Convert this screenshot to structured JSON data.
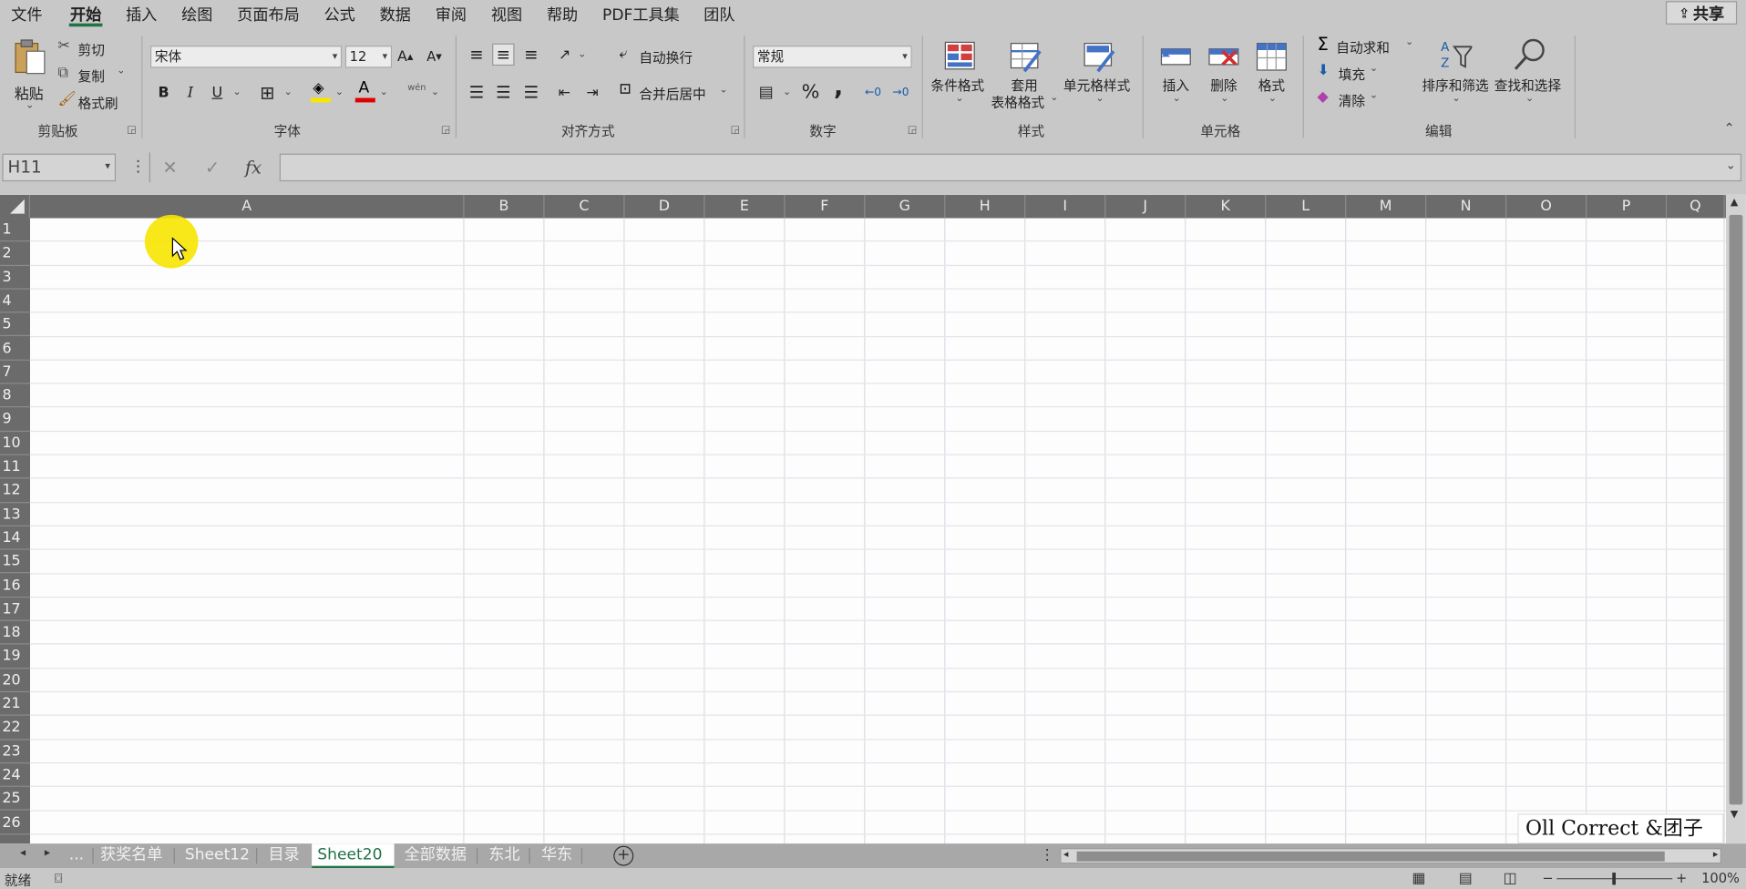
{
  "menu": {
    "items": [
      "文件",
      "开始",
      "插入",
      "绘图",
      "页面布局",
      "公式",
      "数据",
      "审阅",
      "视图",
      "帮助",
      "PDF工具集",
      "团队"
    ],
    "active": "开始",
    "share": "共享"
  },
  "ribbon": {
    "clipboard": {
      "paste": "粘贴",
      "cut": "剪切",
      "copy": "复制",
      "format_painter": "格式刷",
      "label": "剪贴板"
    },
    "font": {
      "name": "宋体",
      "size": "12",
      "bold": "B",
      "italic": "I",
      "underline": "U",
      "phonetic": "wén",
      "label": "字体"
    },
    "alignment": {
      "wrap": "自动换行",
      "merge": "合并后居中",
      "label": "对齐方式"
    },
    "number": {
      "format": "常规",
      "percent": "%",
      "comma": ",",
      "label": "数字"
    },
    "styles": {
      "conditional": "条件格式",
      "table_line1": "套用",
      "table_line2": "表格格式",
      "cell_styles": "单元格样式",
      "label": "样式"
    },
    "cells": {
      "insert": "插入",
      "delete": "删除",
      "format": "格式",
      "label": "单元格"
    },
    "editing": {
      "autosum": "自动求和",
      "fill": "填充",
      "clear": "清除",
      "sort_filter": "排序和筛选",
      "find_select": "查找和选择",
      "label": "编辑"
    }
  },
  "formula_bar": {
    "name_box": "H11",
    "fx": "fx",
    "value": ""
  },
  "sheet": {
    "columns": [
      "A",
      "B",
      "C",
      "D",
      "E",
      "F",
      "G",
      "H",
      "I",
      "J",
      "K",
      "L",
      "M",
      "N",
      "O",
      "P",
      "Q"
    ],
    "rows": [
      "1",
      "2",
      "3",
      "4",
      "5",
      "6",
      "7",
      "8",
      "9",
      "10",
      "11",
      "12",
      "13",
      "14",
      "15",
      "16",
      "17",
      "18",
      "19",
      "20",
      "21",
      "22",
      "23",
      "24",
      "25",
      "26"
    ]
  },
  "tabs": {
    "ellipsis": "...",
    "items": [
      "获奖名单",
      "Sheet12",
      "目录",
      "Sheet20",
      "全部数据",
      "东北",
      "华东"
    ],
    "active": "Sheet20"
  },
  "status": {
    "ready": "就绪",
    "zoom": "100%"
  },
  "watermark": "Oll Correct &团子",
  "colors": {
    "accent": "#217346",
    "cursor_highlight": "#f7e600"
  }
}
